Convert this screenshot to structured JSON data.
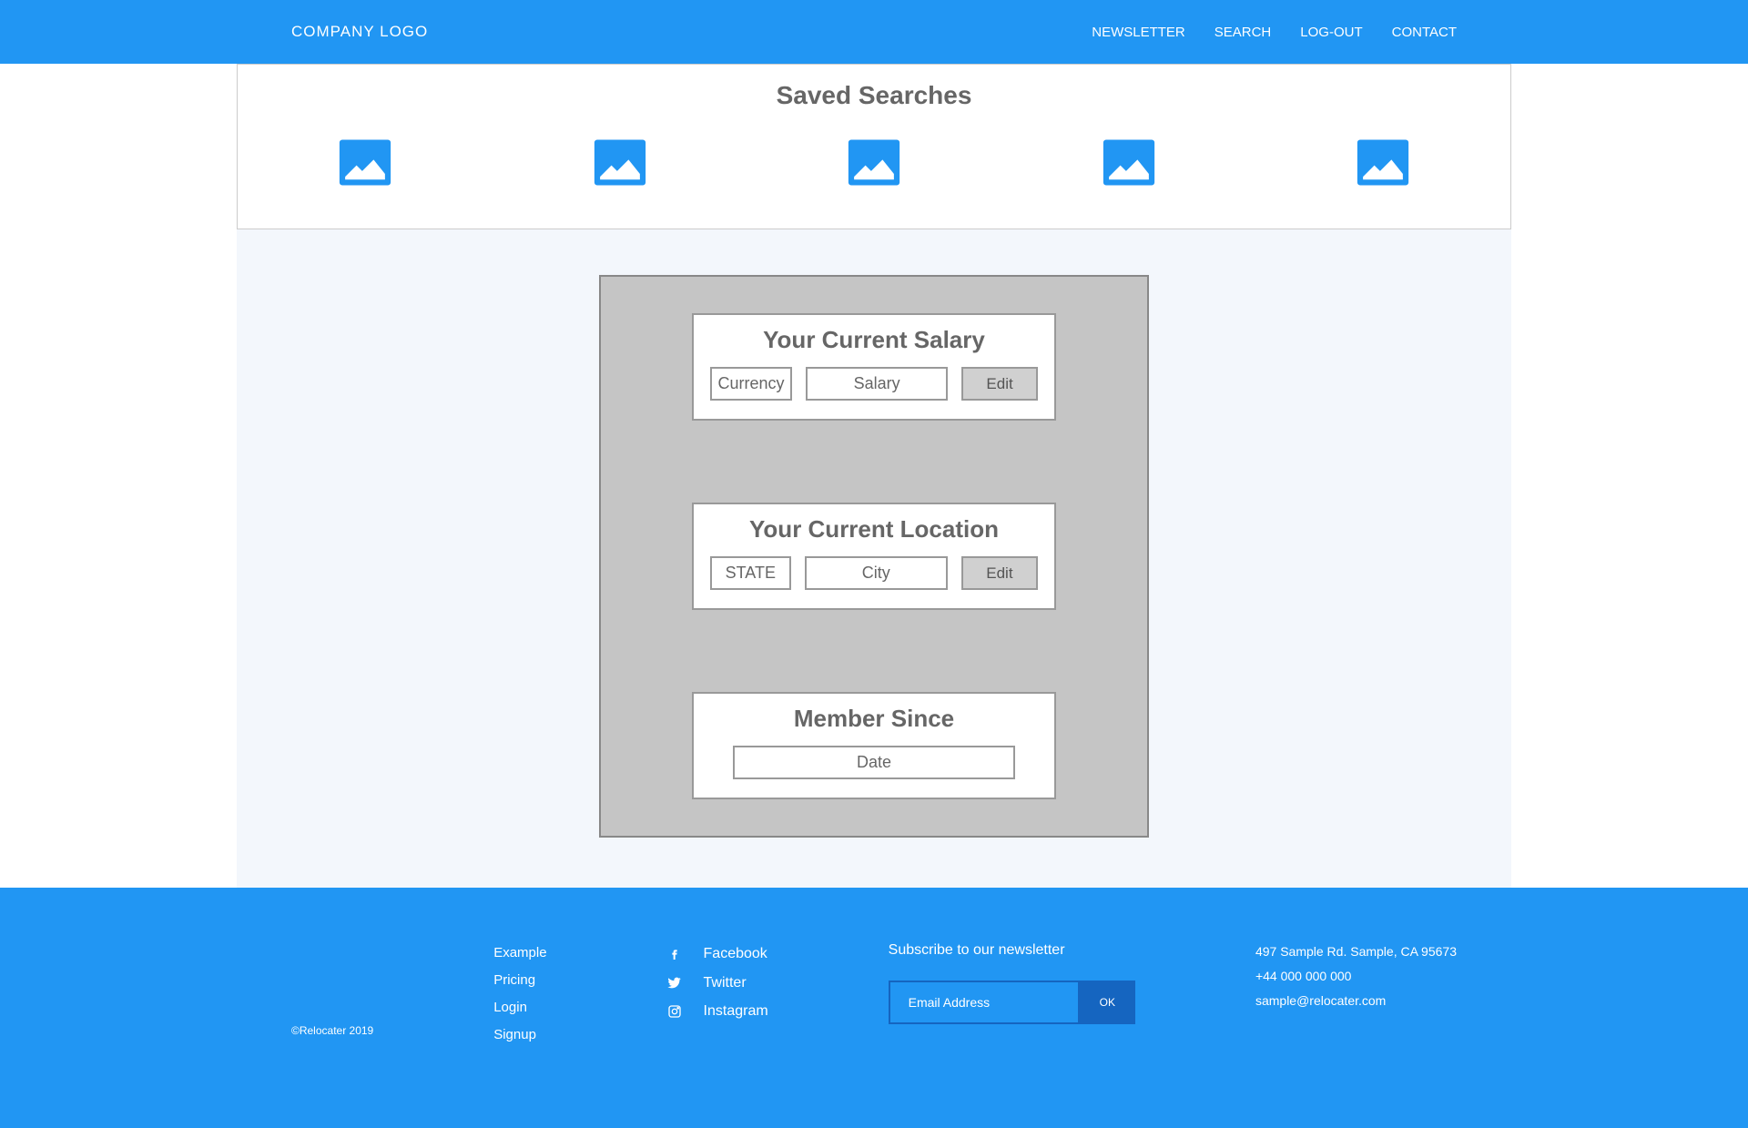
{
  "header": {
    "logo": "COMPANY LOGO",
    "nav": {
      "newsletter": "NEWSLETTER",
      "search": "SEARCH",
      "logout": "LOG-OUT",
      "contact": "CONTACT"
    }
  },
  "saved_searches": {
    "title": "Saved Searches"
  },
  "profile": {
    "salary": {
      "title": "Your Current Salary",
      "currency_label": "Currency",
      "salary_label": "Salary",
      "edit_label": "Edit"
    },
    "location": {
      "title": "Your Current Location",
      "state_label": "STATE",
      "city_label": "City",
      "edit_label": "Edit"
    },
    "member": {
      "title": "Member Since",
      "date_label": "Date"
    }
  },
  "footer": {
    "copyright": "©Relocater 2019",
    "links": {
      "example": "Example",
      "pricing": "Pricing",
      "login": "Login",
      "signup": "Signup"
    },
    "social": {
      "facebook": "Facebook",
      "twitter": "Twitter",
      "instagram": "Instagram"
    },
    "newsletter": {
      "title": "Subscribe to our newsletter",
      "placeholder": "Email Address",
      "button": "OK"
    },
    "contact": {
      "address": "497 Sample Rd. Sample, CA 95673",
      "phone": "+44 000 000 000",
      "email": "sample@relocater.com"
    }
  }
}
